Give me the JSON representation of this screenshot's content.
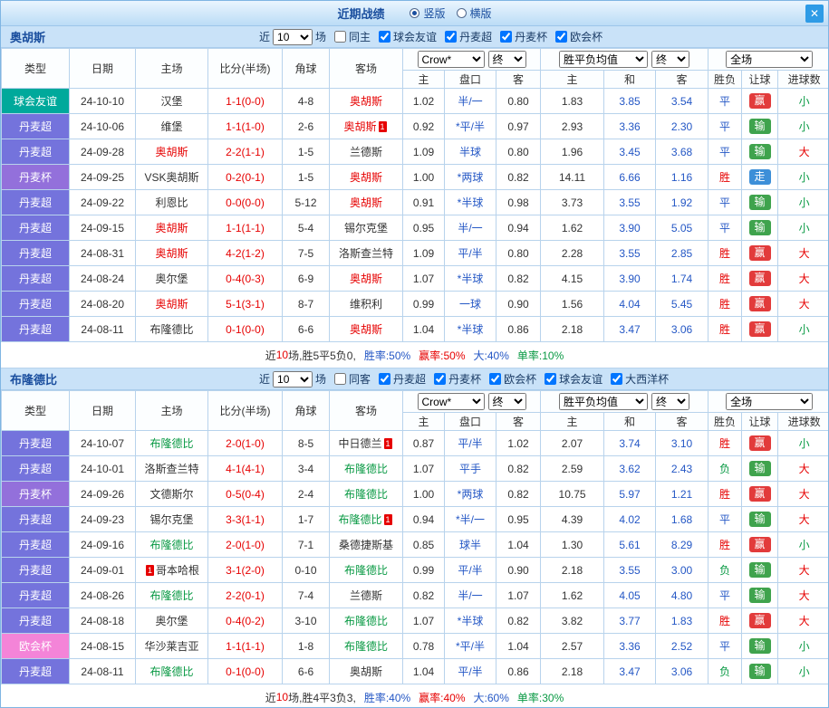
{
  "titlebar": {
    "title": "近期战绩",
    "radio_vertical": "竖版",
    "radio_horizontal": "横版",
    "close": "✕"
  },
  "red_card_label": "1",
  "table_header": {
    "main_cols": [
      "类型",
      "日期",
      "主场",
      "比分(半场)",
      "角球",
      "客场"
    ],
    "odds_source": "Crow*",
    "odds_time": "终",
    "avg_source": "胜平负均值",
    "avg_time": "终",
    "scope": "全场",
    "sub_cols": [
      "主",
      "盘口",
      "客",
      "主",
      "和",
      "客",
      "胜负",
      "让球",
      "进球数"
    ]
  },
  "type_colors": {
    "球会友谊": "#00A99B",
    "丹麦超": "#7473DC",
    "丹麦杯": "#9370DB",
    "欧会杯": "#F484D8"
  },
  "value_colors": {
    "result": {
      "胜": "#E60000",
      "平": "#2457C5",
      "负": "#089943"
    },
    "handicap_result": {
      "赢": "#E23B3B",
      "输": "#3FA34D",
      "走": "#3D8FD8"
    },
    "goals": {
      "大": "#E60000",
      "小": "#089943"
    }
  },
  "sections": [
    {
      "team": "奥胡斯",
      "self_color": "#E60000",
      "filters": {
        "near": "近",
        "count": "10",
        "games": "场",
        "venue": "同主",
        "venue_checked": false,
        "leagues": [
          "球会友谊",
          "丹麦超",
          "丹麦杯",
          "欧会杯"
        ]
      },
      "rows": [
        {
          "type": "球会友谊",
          "date": "24-10-10",
          "home": "汉堡",
          "home_self": false,
          "home_card": "",
          "score": "1-1(0-0)",
          "corner": "4-8",
          "away": "奥胡斯",
          "away_self": true,
          "away_card": "",
          "odds_home": "1.02",
          "handicap": "半/一",
          "odds_away": "0.80",
          "avg_home": "1.83",
          "avg_draw": "3.85",
          "avg_away": "3.54",
          "result": "平",
          "handicap_result": "赢",
          "goals": "小"
        },
        {
          "type": "丹麦超",
          "date": "24-10-06",
          "home": "维堡",
          "home_self": false,
          "home_card": "",
          "score": "1-1(1-0)",
          "corner": "2-6",
          "away": "奥胡斯",
          "away_self": true,
          "away_card": "after",
          "odds_home": "0.92",
          "handicap": "*平/半",
          "odds_away": "0.97",
          "avg_home": "2.93",
          "avg_draw": "3.36",
          "avg_away": "2.30",
          "result": "平",
          "handicap_result": "输",
          "goals": "小"
        },
        {
          "type": "丹麦超",
          "date": "24-09-28",
          "home": "奥胡斯",
          "home_self": true,
          "home_card": "",
          "score": "2-2(1-1)",
          "corner": "1-5",
          "away": "兰德斯",
          "away_self": false,
          "away_card": "",
          "odds_home": "1.09",
          "handicap": "半球",
          "odds_away": "0.80",
          "avg_home": "1.96",
          "avg_draw": "3.45",
          "avg_away": "3.68",
          "result": "平",
          "handicap_result": "输",
          "goals": "大"
        },
        {
          "type": "丹麦杯",
          "date": "24-09-25",
          "home": "VSK奥胡斯",
          "home_self": false,
          "home_card": "",
          "score": "0-2(0-1)",
          "corner": "1-5",
          "away": "奥胡斯",
          "away_self": true,
          "away_card": "",
          "odds_home": "1.00",
          "handicap": "*两球",
          "odds_away": "0.82",
          "avg_home": "14.11",
          "avg_draw": "6.66",
          "avg_away": "1.16",
          "result": "胜",
          "handicap_result": "走",
          "goals": "小"
        },
        {
          "type": "丹麦超",
          "date": "24-09-22",
          "home": "利恩比",
          "home_self": false,
          "home_card": "",
          "score": "0-0(0-0)",
          "corner": "5-12",
          "away": "奥胡斯",
          "away_self": true,
          "away_card": "",
          "odds_home": "0.91",
          "handicap": "*半球",
          "odds_away": "0.98",
          "avg_home": "3.73",
          "avg_draw": "3.55",
          "avg_away": "1.92",
          "result": "平",
          "handicap_result": "输",
          "goals": "小"
        },
        {
          "type": "丹麦超",
          "date": "24-09-15",
          "home": "奥胡斯",
          "home_self": true,
          "home_card": "",
          "score": "1-1(1-1)",
          "corner": "5-4",
          "away": "锡尔克堡",
          "away_self": false,
          "away_card": "",
          "odds_home": "0.95",
          "handicap": "半/一",
          "odds_away": "0.94",
          "avg_home": "1.62",
          "avg_draw": "3.90",
          "avg_away": "5.05",
          "result": "平",
          "handicap_result": "输",
          "goals": "小"
        },
        {
          "type": "丹麦超",
          "date": "24-08-31",
          "home": "奥胡斯",
          "home_self": true,
          "home_card": "",
          "score": "4-2(1-2)",
          "corner": "7-5",
          "away": "洛斯查兰特",
          "away_self": false,
          "away_card": "",
          "odds_home": "1.09",
          "handicap": "平/半",
          "odds_away": "0.80",
          "avg_home": "2.28",
          "avg_draw": "3.55",
          "avg_away": "2.85",
          "result": "胜",
          "handicap_result": "赢",
          "goals": "大"
        },
        {
          "type": "丹麦超",
          "date": "24-08-24",
          "home": "奥尔堡",
          "home_self": false,
          "home_card": "",
          "score": "0-4(0-3)",
          "corner": "6-9",
          "away": "奥胡斯",
          "away_self": true,
          "away_card": "",
          "odds_home": "1.07",
          "handicap": "*半球",
          "odds_away": "0.82",
          "avg_home": "4.15",
          "avg_draw": "3.90",
          "avg_away": "1.74",
          "result": "胜",
          "handicap_result": "赢",
          "goals": "大"
        },
        {
          "type": "丹麦超",
          "date": "24-08-20",
          "home": "奥胡斯",
          "home_self": true,
          "home_card": "",
          "score": "5-1(3-1)",
          "corner": "8-7",
          "away": "维积利",
          "away_self": false,
          "away_card": "",
          "odds_home": "0.99",
          "handicap": "一球",
          "odds_away": "0.90",
          "avg_home": "1.56",
          "avg_draw": "4.04",
          "avg_away": "5.45",
          "result": "胜",
          "handicap_result": "赢",
          "goals": "大"
        },
        {
          "type": "丹麦超",
          "date": "24-08-11",
          "home": "布隆德比",
          "home_self": false,
          "home_card": "",
          "score": "0-1(0-0)",
          "corner": "6-6",
          "away": "奥胡斯",
          "away_self": true,
          "away_card": "",
          "odds_home": "1.04",
          "handicap": "*半球",
          "odds_away": "0.86",
          "avg_home": "2.18",
          "avg_draw": "3.47",
          "avg_away": "3.06",
          "result": "胜",
          "handicap_result": "赢",
          "goals": "小"
        }
      ],
      "summary": {
        "pre": "近",
        "count": "10",
        "mid": "场,胜5平5负0,",
        "win": "胜率:50%",
        "profit": "赢率:50%",
        "big": "大:40%",
        "odd": "单率:10%"
      }
    },
    {
      "team": "布隆德比",
      "self_color": "#089943",
      "filters": {
        "near": "近",
        "count": "10",
        "games": "场",
        "venue": "同客",
        "venue_checked": false,
        "leagues": [
          "丹麦超",
          "丹麦杯",
          "欧会杯",
          "球会友谊",
          "大西洋杯"
        ]
      },
      "rows": [
        {
          "type": "丹麦超",
          "date": "24-10-07",
          "home": "布隆德比",
          "home_self": true,
          "home_card": "",
          "score": "2-0(1-0)",
          "corner": "8-5",
          "away": "中日德兰",
          "away_self": false,
          "away_card": "after",
          "odds_home": "0.87",
          "handicap": "平/半",
          "odds_away": "1.02",
          "avg_home": "2.07",
          "avg_draw": "3.74",
          "avg_away": "3.10",
          "result": "胜",
          "handicap_result": "赢",
          "goals": "小"
        },
        {
          "type": "丹麦超",
          "date": "24-10-01",
          "home": "洛斯查兰特",
          "home_self": false,
          "home_card": "",
          "score": "4-1(4-1)",
          "corner": "3-4",
          "away": "布隆德比",
          "away_self": true,
          "away_card": "",
          "odds_home": "1.07",
          "handicap": "平手",
          "odds_away": "0.82",
          "avg_home": "2.59",
          "avg_draw": "3.62",
          "avg_away": "2.43",
          "result": "负",
          "handicap_result": "输",
          "goals": "大"
        },
        {
          "type": "丹麦杯",
          "date": "24-09-26",
          "home": "文德斯尔",
          "home_self": false,
          "home_card": "",
          "score": "0-5(0-4)",
          "corner": "2-4",
          "away": "布隆德比",
          "away_self": true,
          "away_card": "",
          "odds_home": "1.00",
          "handicap": "*两球",
          "odds_away": "0.82",
          "avg_home": "10.75",
          "avg_draw": "5.97",
          "avg_away": "1.21",
          "result": "胜",
          "handicap_result": "赢",
          "goals": "大"
        },
        {
          "type": "丹麦超",
          "date": "24-09-23",
          "home": "锡尔克堡",
          "home_self": false,
          "home_card": "",
          "score": "3-3(1-1)",
          "corner": "1-7",
          "away": "布隆德比",
          "away_self": true,
          "away_card": "after",
          "odds_home": "0.94",
          "handicap": "*半/一",
          "odds_away": "0.95",
          "avg_home": "4.39",
          "avg_draw": "4.02",
          "avg_away": "1.68",
          "result": "平",
          "handicap_result": "输",
          "goals": "大"
        },
        {
          "type": "丹麦超",
          "date": "24-09-16",
          "home": "布隆德比",
          "home_self": true,
          "home_card": "",
          "score": "2-0(1-0)",
          "corner": "7-1",
          "away": "桑德捷斯基",
          "away_self": false,
          "away_card": "",
          "odds_home": "0.85",
          "handicap": "球半",
          "odds_away": "1.04",
          "avg_home": "1.30",
          "avg_draw": "5.61",
          "avg_away": "8.29",
          "result": "胜",
          "handicap_result": "赢",
          "goals": "小"
        },
        {
          "type": "丹麦超",
          "date": "24-09-01",
          "home": "哥本哈根",
          "home_self": false,
          "home_card": "before",
          "score": "3-1(2-0)",
          "corner": "0-10",
          "away": "布隆德比",
          "away_self": true,
          "away_card": "",
          "odds_home": "0.99",
          "handicap": "平/半",
          "odds_away": "0.90",
          "avg_home": "2.18",
          "avg_draw": "3.55",
          "avg_away": "3.00",
          "result": "负",
          "handicap_result": "输",
          "goals": "大"
        },
        {
          "type": "丹麦超",
          "date": "24-08-26",
          "home": "布隆德比",
          "home_self": true,
          "home_card": "",
          "score": "2-2(0-1)",
          "corner": "7-4",
          "away": "兰德斯",
          "away_self": false,
          "away_card": "",
          "odds_home": "0.82",
          "handicap": "半/一",
          "odds_away": "1.07",
          "avg_home": "1.62",
          "avg_draw": "4.05",
          "avg_away": "4.80",
          "result": "平",
          "handicap_result": "输",
          "goals": "大"
        },
        {
          "type": "丹麦超",
          "date": "24-08-18",
          "home": "奥尔堡",
          "home_self": false,
          "home_card": "",
          "score": "0-4(0-2)",
          "corner": "3-10",
          "away": "布隆德比",
          "away_self": true,
          "away_card": "",
          "odds_home": "1.07",
          "handicap": "*半球",
          "odds_away": "0.82",
          "avg_home": "3.82",
          "avg_draw": "3.77",
          "avg_away": "1.83",
          "result": "胜",
          "handicap_result": "赢",
          "goals": "大"
        },
        {
          "type": "欧会杯",
          "date": "24-08-15",
          "home": "华沙莱吉亚",
          "home_self": false,
          "home_card": "",
          "score": "1-1(1-1)",
          "corner": "1-8",
          "away": "布隆德比",
          "away_self": true,
          "away_card": "",
          "odds_home": "0.78",
          "handicap": "*平/半",
          "odds_away": "1.04",
          "avg_home": "2.57",
          "avg_draw": "3.36",
          "avg_away": "2.52",
          "result": "平",
          "handicap_result": "输",
          "goals": "小"
        },
        {
          "type": "丹麦超",
          "date": "24-08-11",
          "home": "布隆德比",
          "home_self": true,
          "home_card": "",
          "score": "0-1(0-0)",
          "corner": "6-6",
          "away": "奥胡斯",
          "away_self": false,
          "away_card": "",
          "odds_home": "1.04",
          "handicap": "平/半",
          "odds_away": "0.86",
          "avg_home": "2.18",
          "avg_draw": "3.47",
          "avg_away": "3.06",
          "result": "负",
          "handicap_result": "输",
          "goals": "小"
        }
      ],
      "summary": {
        "pre": "近",
        "count": "10",
        "mid": "场,胜4平3负3,",
        "win": "胜率:40%",
        "profit": "赢率:40%",
        "big": "大:60%",
        "odd": "单率:30%"
      }
    }
  ]
}
